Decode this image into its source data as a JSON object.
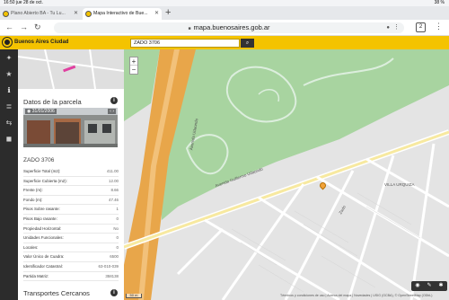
{
  "status": {
    "time": "16:50",
    "date": "jue 28 de oct.",
    "battery": "38 %"
  },
  "tabs": [
    {
      "label": "Plano Abierto BA - Tu Lu..."
    },
    {
      "label": "Mapa Interactivo de Bue..."
    }
  ],
  "new_tab_glyph": "+",
  "url": "mapa.buenosaires.gob.ar",
  "tab_count": "2",
  "app": {
    "brand": "Buenos Aires Ciudad",
    "search_value": "ZADO 3706"
  },
  "panel": {
    "title": "Datos de la parcela",
    "photo_date": "31/01/2006",
    "address": "ZADO 3706",
    "rows": [
      {
        "label": "Superficie Total (m2):",
        "value": "411.00"
      },
      {
        "label": "Superficie Cubierta (m2):",
        "value": "12.00"
      },
      {
        "label": "Frente (m):",
        "value": "8.66"
      },
      {
        "label": "Fondo (m):",
        "value": "47.46"
      },
      {
        "label": "Pisos Sobre rasante:",
        "value": "1"
      },
      {
        "label": "Pisos Bajo rasante:",
        "value": "0"
      },
      {
        "label": "Propiedad Horizontal:",
        "value": "No"
      },
      {
        "label": "Unidades Funcionales:",
        "value": "0"
      },
      {
        "label": "Locales:",
        "value": "0"
      },
      {
        "label": "Valor Único de Cuadra:",
        "value": "6500"
      },
      {
        "label": "Identificador Catastral:",
        "value": "63-010-039"
      },
      {
        "label": "Partida Matriz:",
        "value": "358138"
      }
    ],
    "section2_title": "Transportes Cercanos"
  },
  "map": {
    "street_labels": [
      "Avenida Udaondo",
      "Avenida Guillermo Udaondo",
      "Zado",
      "VILLA URQUIZA"
    ],
    "attribution": "Términos y condiciones de uso | Acerca del mapa | Novedades | USIG (GCBA), © OpenStreetMap (ODbL)",
    "scale": "50 m"
  },
  "colors": {
    "accent": "#f4c300",
    "park": "#a8d4a0",
    "highway": "#e8a64a",
    "sidebar": "#2c2c2c"
  }
}
